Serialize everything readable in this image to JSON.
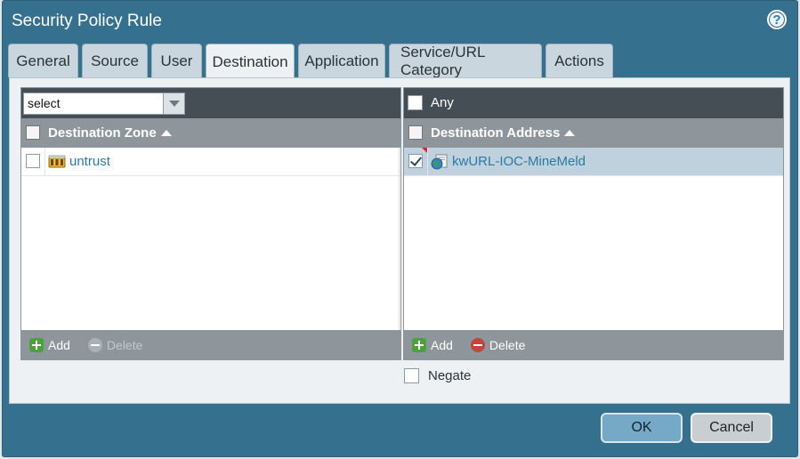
{
  "dialog": {
    "title": "Security Policy Rule"
  },
  "tabs": [
    {
      "label": "General"
    },
    {
      "label": "Source"
    },
    {
      "label": "User"
    },
    {
      "label": "Destination"
    },
    {
      "label": "Application"
    },
    {
      "label": "Service/URL Category"
    },
    {
      "label": "Actions"
    }
  ],
  "active_tab": "Destination",
  "zone_panel": {
    "select_value": "select",
    "column_header": "Destination Zone",
    "rows": [
      {
        "label": "untrust",
        "checked": false
      }
    ],
    "add_label": "Add",
    "delete_label": "Delete"
  },
  "address_panel": {
    "any_label": "Any",
    "column_header": "Destination Address",
    "rows": [
      {
        "label": "kwURL-IOC-MineMeld",
        "checked": true
      }
    ],
    "add_label": "Add",
    "delete_label": "Delete"
  },
  "negate_label": "Negate",
  "buttons": {
    "ok": "OK",
    "cancel": "Cancel"
  },
  "colors": {
    "dialog_bg": "#35708f",
    "header_bg": "#454d55",
    "column_header_bg": "#8e969c",
    "link": "#2a7aa8",
    "add_icon": "#4aa33a",
    "delete_icon": "#c94238"
  }
}
